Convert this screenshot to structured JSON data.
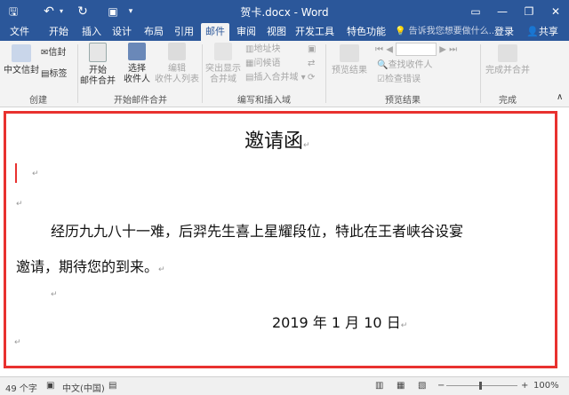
{
  "window": {
    "title": "贺卡.docx - Word",
    "sign_in": "登录",
    "share": "共享"
  },
  "tabs": [
    "文件",
    "开始",
    "插入",
    "设计",
    "布局",
    "引用",
    "邮件",
    "审阅",
    "视图",
    "开发工具",
    "特色功能"
  ],
  "tell_me": "告诉我您想要做什么...",
  "ribbon": {
    "create": {
      "chinese_envelope": "中文信封",
      "envelope": "信封",
      "labels": "标签",
      "group": "创建"
    },
    "start": {
      "start_merge": "开始",
      "start_merge2": "邮件合并",
      "select": "选择",
      "select2": "收件人",
      "edit": "编辑",
      "edit2": "收件人列表",
      "group": "开始邮件合并"
    },
    "write": {
      "highlight": "突出显示",
      "highlight2": "合并域",
      "address": "地址块",
      "greeting": "问候语",
      "insert_field": "插入合并域",
      "group": "编写和插入域"
    },
    "preview": {
      "preview_results": "预览结果",
      "find_recipient": "查找收件人",
      "check_errors": "检查错误",
      "group": "预览结果"
    },
    "finish": {
      "finish_merge": "完成并合并",
      "group": "完成"
    }
  },
  "document": {
    "title": "邀请函",
    "para1": "经历九九八十一难，后羿先生喜上星耀段位，特此在王者峡谷设宴",
    "para2": "邀请，期待您的到来。",
    "date": "2019 年 1 月 10 日"
  },
  "status": {
    "words": "49 个字",
    "language": "中文(中国)",
    "zoom": "100%"
  },
  "colors": {
    "titlebar": "#2b579a",
    "frame": "#e8312f"
  }
}
